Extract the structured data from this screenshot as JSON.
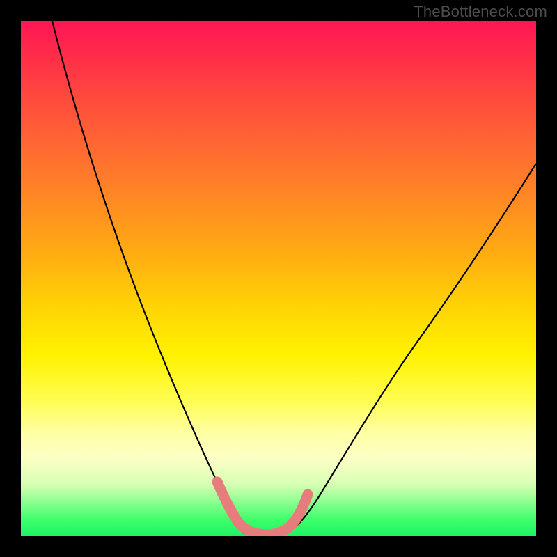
{
  "watermark": "TheBottleneck.com",
  "colors": {
    "black": "#000000",
    "curve_black": "#000000",
    "pink_curve": "#e77c7c",
    "gradient_stops": [
      "#ff1555",
      "#ff2a4a",
      "#ff4a3d",
      "#ff6a32",
      "#ff8a23",
      "#ffab12",
      "#ffd205",
      "#fff200",
      "#fffd55",
      "#ffffa5",
      "#fcffc5",
      "#d6ffb2",
      "#7dff8a",
      "#3cff6a",
      "#1ef264"
    ]
  },
  "chart_data": {
    "type": "line",
    "title": "",
    "xlabel": "",
    "ylabel": "",
    "xlim": [
      0,
      100
    ],
    "ylim": [
      0,
      100
    ],
    "grid": false,
    "legend": false,
    "series": [
      {
        "name": "black-curve-left",
        "x": [
          6,
          10,
          15,
          20,
          25,
          30,
          35,
          40,
          42
        ],
        "y": [
          100,
          88,
          74,
          60,
          47,
          34,
          22,
          8,
          3
        ]
      },
      {
        "name": "black-curve-right",
        "x": [
          52,
          55,
          60,
          65,
          70,
          75,
          80,
          85,
          90,
          95,
          100
        ],
        "y": [
          3,
          7,
          15,
          24,
          33,
          41,
          48,
          55,
          62,
          68,
          73
        ]
      },
      {
        "name": "pink-bottom-segment",
        "x": [
          38,
          40,
          42,
          44,
          46,
          48,
          50,
          52,
          54
        ],
        "y": [
          11,
          6,
          3,
          2,
          2,
          2,
          3,
          6,
          10
        ]
      }
    ],
    "annotations": []
  }
}
